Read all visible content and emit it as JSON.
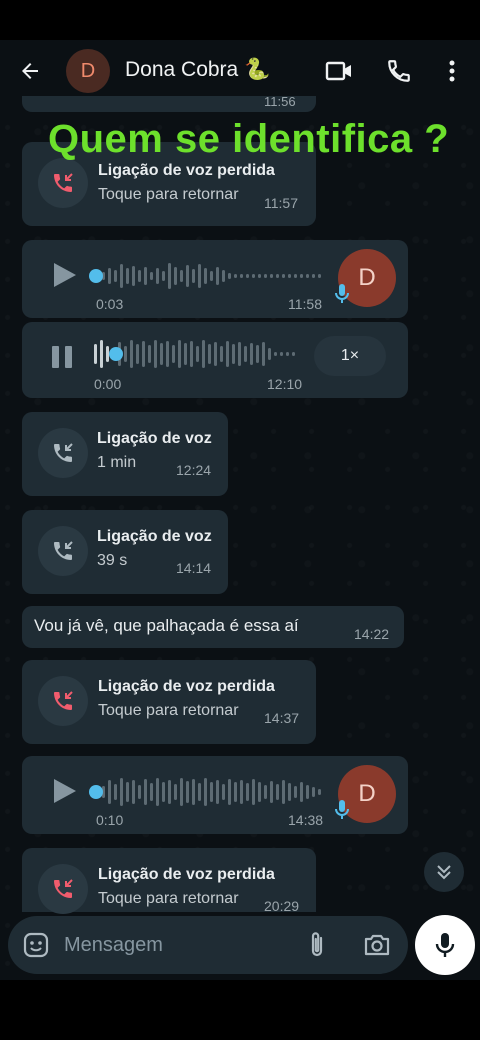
{
  "header": {
    "contact_initial": "D",
    "contact_name": "Dona Cobra 🐍",
    "icons": [
      "back-arrow-icon",
      "video-call-icon",
      "voice-call-icon",
      "more-options-icon"
    ]
  },
  "overlay_text": "Quem se identifica ?",
  "partial_top_time": "11:56",
  "messages": [
    {
      "type": "missed-call",
      "title": "Ligação de voz perdida",
      "subtitle": "Toque para retornar",
      "time": "11:57"
    },
    {
      "type": "voice-note",
      "duration": "0:03",
      "time": "11:58",
      "avatar_initial": "D",
      "progress": 0.0
    },
    {
      "type": "voice-note-playing",
      "duration": "0:00",
      "time": "12:10",
      "speed": "1×",
      "progress": 0.06
    },
    {
      "type": "call",
      "title": "Ligação de voz",
      "subtitle": "1 min",
      "time": "12:24"
    },
    {
      "type": "call",
      "title": "Ligação de voz",
      "subtitle": "39 s",
      "time": "14:14"
    },
    {
      "type": "text",
      "text": "Vou já vê, que palhaçada é essa aí",
      "time": "14:22"
    },
    {
      "type": "missed-call",
      "title": "Ligação de voz perdida",
      "subtitle": "Toque para retornar",
      "time": "14:37"
    },
    {
      "type": "voice-note",
      "duration": "0:10",
      "time": "14:38",
      "avatar_initial": "D",
      "progress": 0.0
    },
    {
      "type": "missed-call",
      "title": "Ligação de voz perdida",
      "subtitle": "Toque para retornar",
      "time": "20:29"
    }
  ],
  "composer": {
    "placeholder": "Mensagem"
  },
  "colors": {
    "background": "#0b1014",
    "bubble": "#1f2c34",
    "missed_call_red": "#f15c6d",
    "overlay_green": "#6de02c",
    "voice_blue": "#53bdeb"
  }
}
